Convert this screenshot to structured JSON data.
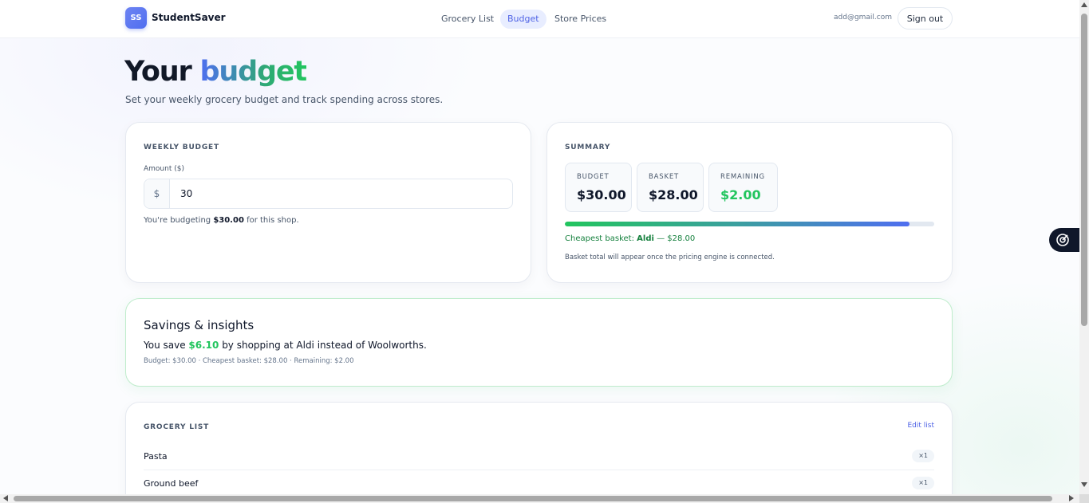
{
  "brand": {
    "badge": "SS",
    "name": "StudentSaver"
  },
  "nav": {
    "links": [
      {
        "label": "Grocery List",
        "active": false
      },
      {
        "label": "Budget",
        "active": true
      },
      {
        "label": "Store Prices",
        "active": false
      }
    ],
    "user_email": "add@gmail.com",
    "signout_label": "Sign out"
  },
  "page": {
    "title_part1": "Your ",
    "title_part2": "budget",
    "subtitle": "Set your weekly grocery budget and track spending across stores."
  },
  "weekly_budget": {
    "label": "WEEKLY BUDGET",
    "field_label": "Amount ($)",
    "prefix": "$",
    "value": "30",
    "note_prefix": "You're budgeting ",
    "note_amount": "$30.00",
    "note_suffix": " for this shop."
  },
  "summary": {
    "label": "SUMMARY",
    "stats": [
      {
        "label": "BUDGET",
        "value": "$30.00"
      },
      {
        "label": "BASKET",
        "value": "$28.00"
      },
      {
        "label": "REMAINING",
        "value": "$2.00"
      }
    ],
    "progress_fraction": 0.933,
    "cheapest_prefix": "Cheapest basket: ",
    "cheapest_store": "Aldi",
    "cheapest_suffix": " — $28.00",
    "engine_note": "Basket total will appear once the pricing engine is connected."
  },
  "insights": {
    "title": "Savings & insights",
    "line_prefix": "You save ",
    "line_amount": "$6.10",
    "line_suffix": " by shopping at Aldi instead of Woolworths.",
    "meta": "Budget: $30.00 · Cheapest basket: $28.00 · Remaining: $2.00"
  },
  "grocery_list": {
    "label": "GROCERY LIST",
    "edit_label": "Edit list",
    "items": [
      {
        "name": "Pasta",
        "qty": "×1"
      },
      {
        "name": "Ground beef",
        "qty": "×1"
      }
    ]
  },
  "colors": {
    "accent": "#4f63e6",
    "positive": "#22c55e"
  },
  "icons": {
    "fab": "target-icon"
  }
}
